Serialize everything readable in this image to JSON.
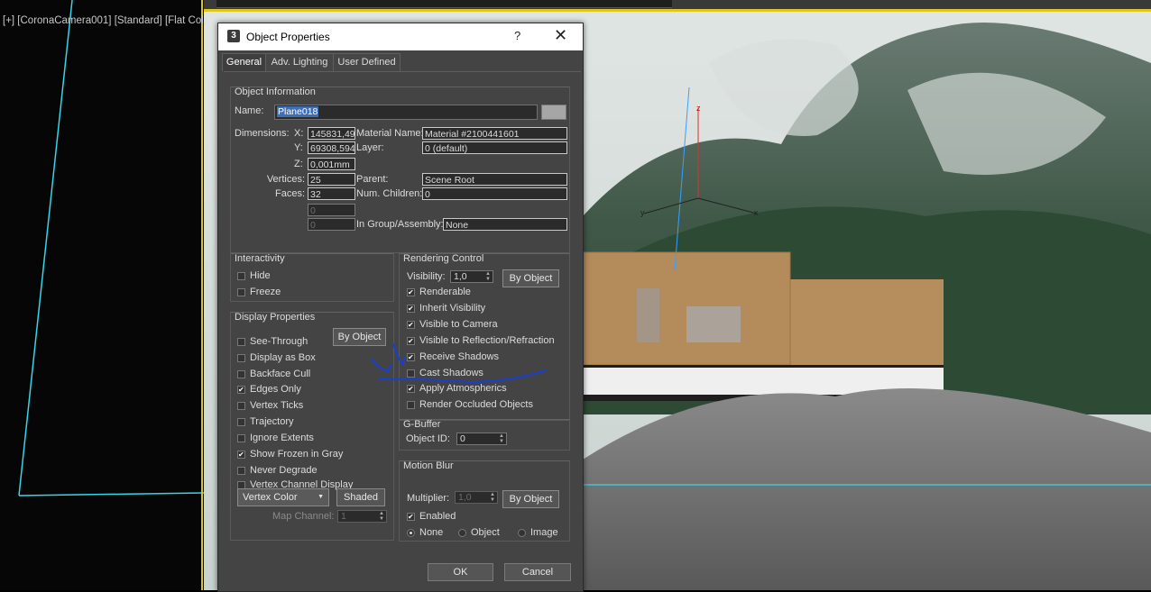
{
  "viewport": {
    "label": "[+] [CoronaCamera001] [Standard] [Flat Color]"
  },
  "dialog": {
    "title": "Object Properties",
    "help_glyph": "?",
    "close_glyph": "✕",
    "tabs": [
      "General",
      "Adv. Lighting",
      "User Defined"
    ],
    "active_tab": "General",
    "object_info": {
      "title": "Object Information",
      "name_label": "Name:",
      "name_value": "Plane018",
      "dimensions_label": "Dimensions:",
      "x_label": "X:",
      "x_value": "145831,49",
      "y_label": "Y:",
      "y_value": "69308,594",
      "z_label": "Z:",
      "z_value": "0,001mm",
      "vertices_label": "Vertices:",
      "vertices_value": "25",
      "faces_label": "Faces:",
      "faces_value": "32",
      "extra1_value": "0",
      "extra2_value": "0",
      "material_name_label": "Material Name:",
      "material_name_value": "Material #2100441601",
      "layer_label": "Layer:",
      "layer_value": "0 (default)",
      "parent_label": "Parent:",
      "parent_value": "Scene Root",
      "num_children_label": "Num. Children:",
      "num_children_value": "0",
      "in_group_label": "In Group/Assembly:",
      "in_group_value": "None"
    },
    "interactivity": {
      "title": "Interactivity",
      "hide": "Hide",
      "hide_checked": false,
      "freeze": "Freeze",
      "freeze_checked": false
    },
    "display": {
      "title": "Display Properties",
      "by_object": "By Object",
      "items": [
        {
          "label": "See-Through",
          "checked": false
        },
        {
          "label": "Display as Box",
          "checked": false
        },
        {
          "label": "Backface Cull",
          "checked": false
        },
        {
          "label": "Edges Only",
          "checked": true
        },
        {
          "label": "Vertex Ticks",
          "checked": false
        },
        {
          "label": "Trajectory",
          "checked": false
        },
        {
          "label": "Ignore Extents",
          "checked": false
        },
        {
          "label": "Show Frozen in Gray",
          "checked": true
        },
        {
          "label": "Never Degrade",
          "checked": false
        },
        {
          "label": "Vertex Channel Display",
          "checked": false
        }
      ],
      "vertex_color": "Vertex Color",
      "shaded": "Shaded",
      "map_channel_label": "Map Channel:",
      "map_channel_value": "1"
    },
    "rendering": {
      "title": "Rendering Control",
      "visibility_label": "Visibility:",
      "visibility_value": "1,0",
      "by_object": "By Object",
      "items": [
        {
          "label": "Renderable",
          "checked": true
        },
        {
          "label": "Inherit Visibility",
          "checked": true
        },
        {
          "label": "Visible to Camera",
          "checked": true
        },
        {
          "label": "Visible to Reflection/Refraction",
          "checked": true
        },
        {
          "label": "Receive Shadows",
          "checked": true
        },
        {
          "label": "Cast Shadows",
          "checked": false
        },
        {
          "label": "Apply Atmospherics",
          "checked": true
        },
        {
          "label": "Render Occluded Objects",
          "checked": false
        }
      ]
    },
    "gbuffer": {
      "title": "G-Buffer",
      "object_id_label": "Object ID:",
      "object_id_value": "0"
    },
    "motion_blur": {
      "title": "Motion Blur",
      "multiplier_label": "Multiplier:",
      "multiplier_value": "1,0",
      "by_object": "By Object",
      "enabled": "Enabled",
      "enabled_checked": true,
      "radios": [
        "None",
        "Object",
        "Image"
      ],
      "selected": "None"
    },
    "ok": "OK",
    "cancel": "Cancel"
  }
}
